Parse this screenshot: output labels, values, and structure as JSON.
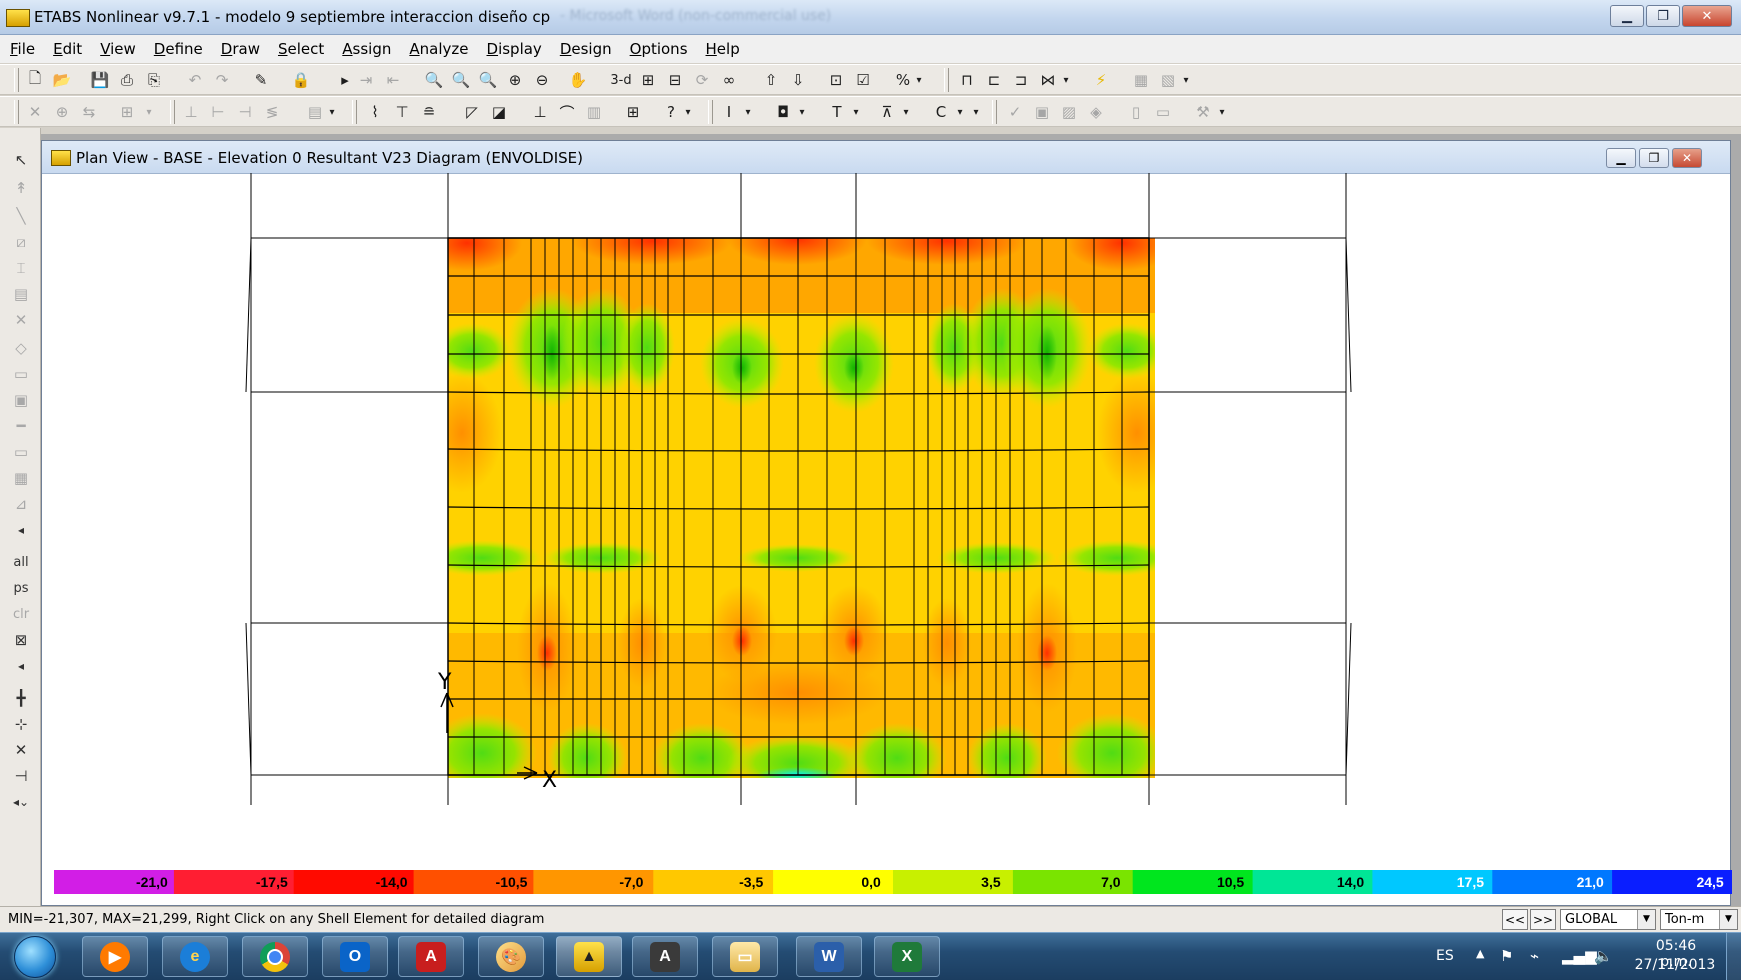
{
  "app": {
    "title": "ETABS Nonlinear v9.7.1 - modelo 9  septiembre interaccion diseño cp",
    "background_title": "- Microsoft Word (non-commercial use)",
    "window_controls": [
      "minimize",
      "restore",
      "close"
    ]
  },
  "menu": [
    "File",
    "Edit",
    "View",
    "Define",
    "Draw",
    "Select",
    "Assign",
    "Analyze",
    "Display",
    "Design",
    "Options",
    "Help"
  ],
  "toolbar": {
    "view_3d_label": "3-d",
    "pct_label": "%"
  },
  "left_toolbar": {
    "all_label": "all",
    "ps_label": "ps",
    "clr_label": "clr"
  },
  "window": {
    "title": "Plan View - BASE - Elevation 0    Resultant V23 Diagram    (ENVOLDISE)"
  },
  "plot": {
    "axis_y_label": "Y",
    "axis_x_label": "X",
    "colors": {
      "red": "#ff3000",
      "orange": "#ff8c00",
      "yellow": "#ffff00",
      "green": "#50dc14",
      "cyan": "#00f0f0"
    }
  },
  "legend": {
    "labels": [
      "-21,0",
      "-17,5",
      "-14,0",
      "-10,5",
      "-7,0",
      "-3,5",
      "0,0",
      "3,5",
      "7,0",
      "10,5",
      "14,0",
      "17,5",
      "21,0",
      "24,5"
    ],
    "colors": [
      "#d21ee6",
      "#ff1e32",
      "#ff0a00",
      "#ff5000",
      "#ff9600",
      "#ffc800",
      "#ffff00",
      "#c8f000",
      "#7ae400",
      "#00e61e",
      "#00e696",
      "#00c8ff",
      "#0078ff",
      "#0a1eff"
    ]
  },
  "status": {
    "message": "MIN=-21,307, MAX=21,299, Right Click on any Shell Element for detailed diagram",
    "nav_prev": "<<",
    "nav_next": ">>",
    "coord_system": "GLOBAL",
    "units": "Ton-m"
  },
  "taskbar": {
    "apps": [
      "media-player",
      "internet-explorer",
      "chrome",
      "outlook",
      "acrobat",
      "paint",
      "etabs",
      "autocad",
      "file-explorer",
      "word",
      "excel"
    ],
    "outlook_label": "O",
    "acrobat_label": "A",
    "autocad_label": "A",
    "word_label": "W",
    "excel_label": "X",
    "language": "ES",
    "time": "05:46 p.m.",
    "date": "27/11/2013"
  }
}
